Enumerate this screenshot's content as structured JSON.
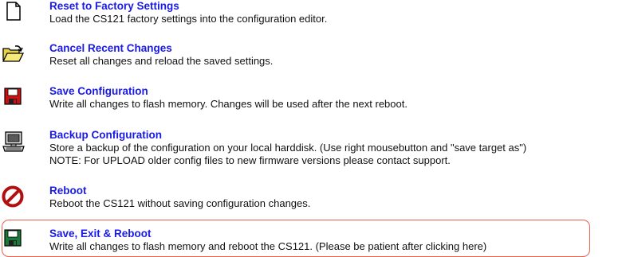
{
  "items": [
    {
      "title": "Reset to Factory Settings",
      "desc": [
        "Load the CS121 factory settings into the configuration editor."
      ],
      "icon": "blank-document-icon"
    },
    {
      "title": "Cancel Recent Changes",
      "desc": [
        "Reset all changes and reload the saved settings."
      ],
      "icon": "open-folder-icon"
    },
    {
      "title": "Save Configuration",
      "desc": [
        "Write all changes to flash memory. Changes will be used after the next reboot."
      ],
      "icon": "red-floppy-disk-icon"
    },
    {
      "title": "Backup Configuration",
      "desc": [
        "Store a backup of the configuration on your local harddisk. (Use right mousebutton and \"save target as\")",
        "NOTE: For UPLOAD older config files to new firmware versions please contact support."
      ],
      "icon": "computer-icon"
    },
    {
      "title": "Reboot",
      "desc": [
        "Reboot the CS121 without saving configuration changes."
      ],
      "icon": "prohibited-icon"
    },
    {
      "title": "Save, Exit & Reboot",
      "desc": [
        "Write all changes to flash memory and reboot the CS121. (Please be patient after clicking here)"
      ],
      "icon": "green-floppy-disk-icon"
    }
  ],
  "colors": {
    "link": "#1a1ae6",
    "text": "#111111",
    "highlight_border": "#e8604a",
    "prohibited_red": "#b01010",
    "floppy_red": "#d01010",
    "floppy_green": "#1a7a3a"
  }
}
